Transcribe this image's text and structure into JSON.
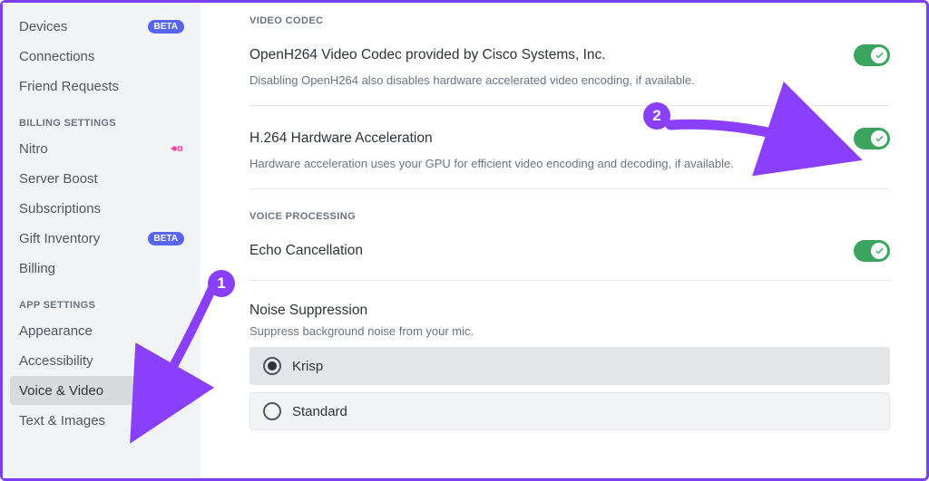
{
  "sidebar": {
    "items_top": [
      {
        "label": "Devices",
        "badge": "BETA"
      },
      {
        "label": "Connections"
      },
      {
        "label": "Friend Requests"
      }
    ],
    "billing_header": "BILLING SETTINGS",
    "billing_items": [
      {
        "label": "Nitro",
        "icon": "nitro"
      },
      {
        "label": "Server Boost"
      },
      {
        "label": "Subscriptions"
      },
      {
        "label": "Gift Inventory",
        "badge": "BETA"
      },
      {
        "label": "Billing"
      }
    ],
    "app_header": "APP SETTINGS",
    "app_items": [
      {
        "label": "Appearance"
      },
      {
        "label": "Accessibility"
      },
      {
        "label": "Voice & Video",
        "selected": true
      },
      {
        "label": "Text & Images"
      }
    ]
  },
  "main": {
    "video_codec_header": "VIDEO CODEC",
    "openh264": {
      "title": "OpenH264 Video Codec provided by Cisco Systems, Inc.",
      "desc": "Disabling OpenH264 also disables hardware accelerated video encoding, if available.",
      "enabled": true
    },
    "hwaccel": {
      "title": "H.264 Hardware Acceleration",
      "desc": "Hardware acceleration uses your GPU for efficient video encoding and decoding, if available.",
      "enabled": true
    },
    "voice_processing_header": "VOICE PROCESSING",
    "echo": {
      "title": "Echo Cancellation",
      "enabled": true
    },
    "noise": {
      "title": "Noise Suppression",
      "desc": "Suppress background noise from your mic.",
      "options": [
        "Krisp",
        "Standard"
      ],
      "selected": "Krisp"
    }
  },
  "annotations": {
    "step1": "1",
    "step2": "2"
  }
}
